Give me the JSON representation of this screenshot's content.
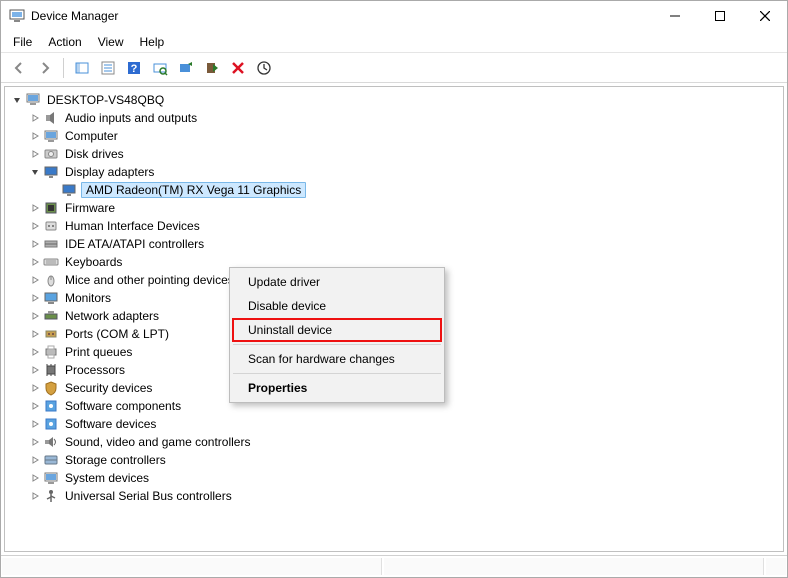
{
  "window": {
    "title": "Device Manager"
  },
  "menus": {
    "file": "File",
    "action": "Action",
    "view": "View",
    "help": "Help"
  },
  "tree": {
    "root": "DESKTOP-VS48QBQ",
    "items": [
      {
        "label": "Audio inputs and outputs",
        "icon": "audio"
      },
      {
        "label": "Computer",
        "icon": "computer"
      },
      {
        "label": "Disk drives",
        "icon": "disk"
      },
      {
        "label": "Display adapters",
        "icon": "display",
        "expanded": true,
        "children": [
          {
            "label": "AMD Radeon(TM) RX Vega 11 Graphics",
            "icon": "display",
            "selected": true
          }
        ]
      },
      {
        "label": "Firmware",
        "icon": "firmware"
      },
      {
        "label": "Human Interface Devices",
        "icon": "hid"
      },
      {
        "label": "IDE ATA/ATAPI controllers",
        "icon": "ide"
      },
      {
        "label": "Keyboards",
        "icon": "keyboard"
      },
      {
        "label": "Mice and other pointing devices",
        "icon": "mouse"
      },
      {
        "label": "Monitors",
        "icon": "monitor"
      },
      {
        "label": "Network adapters",
        "icon": "network"
      },
      {
        "label": "Ports (COM & LPT)",
        "icon": "port"
      },
      {
        "label": "Print queues",
        "icon": "printer"
      },
      {
        "label": "Processors",
        "icon": "cpu"
      },
      {
        "label": "Security devices",
        "icon": "security"
      },
      {
        "label": "Software components",
        "icon": "software"
      },
      {
        "label": "Software devices",
        "icon": "software"
      },
      {
        "label": "Sound, video and game controllers",
        "icon": "sound"
      },
      {
        "label": "Storage controllers",
        "icon": "storage"
      },
      {
        "label": "System devices",
        "icon": "system"
      },
      {
        "label": "Universal Serial Bus controllers",
        "icon": "usb"
      }
    ]
  },
  "context_menu": {
    "update_driver": "Update driver",
    "disable_device": "Disable device",
    "uninstall_device": "Uninstall device",
    "scan": "Scan for hardware changes",
    "properties": "Properties"
  }
}
